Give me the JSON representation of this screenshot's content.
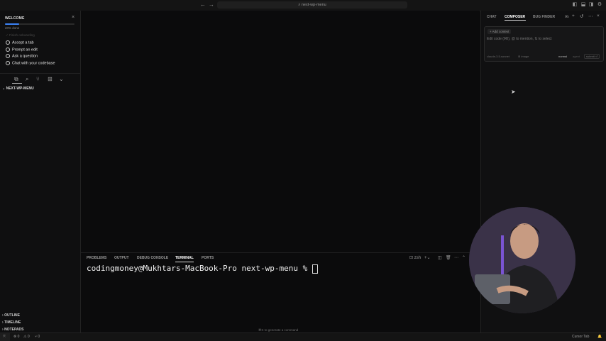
{
  "titlebar": {
    "back_icon": "arrow-left-icon",
    "forward_icon": "arrow-right-icon",
    "search_text": "⌕ next-wp-menu",
    "layout_icons": [
      "sidebar-toggle-icon",
      "panel-toggle-icon",
      "secondary-sidebar-icon",
      "settings-icon"
    ]
  },
  "sidebar": {
    "welcome_title": "WELCOME",
    "close_glyph": "×",
    "progress_label": "20% done",
    "progress_fraction": 0.2,
    "completed_item": "✓ Finish onboarding",
    "tasks": [
      "Accept a tab",
      "Prompt an edit",
      "Ask a question",
      "Chat with your codebase"
    ],
    "folder_name": "NEXT-WP-MENU",
    "bottom_sections": [
      "OUTLINE",
      "TIMELINE",
      "NOTEPADS"
    ]
  },
  "panel": {
    "tabs": [
      "PROBLEMS",
      "OUTPUT",
      "DEBUG CONSOLE",
      "TERMINAL",
      "PORTS"
    ],
    "active_tab": "TERMINAL",
    "shell_label": "zsh",
    "prompt": "codingmoney@Mukhtars-MacBook-Pro next-wp-menu % ",
    "hint": "⌘K to generate a command"
  },
  "rightpanel": {
    "tabs": [
      "CHAT",
      "COMPOSER",
      "BUG FINDER"
    ],
    "active_tab": "COMPOSER",
    "shortcut": "⌘I",
    "add_context": "+ Add context",
    "placeholder": "Edit code (⌘I), @ to mention, ⇅ to select",
    "model": "claude-3.5-sonnet",
    "image": "⊞ image",
    "mode_normal": "normal",
    "mode_agent": "agent",
    "submit": "submit ⏎"
  },
  "statusbar": {
    "errors": "⊗ 0",
    "warnings": "⚠ 0",
    "ports": "⑂ 0",
    "cursor_tab": "Cursor Tab"
  },
  "colors": {
    "accent": "#3b82f6",
    "background": "#0b0b0c"
  }
}
